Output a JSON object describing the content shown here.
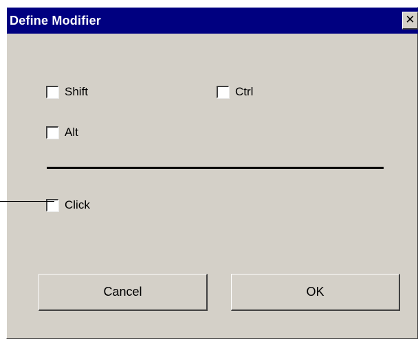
{
  "dialog": {
    "title": "Define Modifier",
    "close_label": "✕"
  },
  "modifiers": {
    "shift": {
      "label": "Shift",
      "checked": false
    },
    "ctrl": {
      "label": "Ctrl",
      "checked": false
    },
    "alt": {
      "label": "Alt",
      "checked": false
    },
    "click": {
      "label": "Click",
      "checked": false
    }
  },
  "buttons": {
    "cancel_label": "Cancel",
    "ok_label": "OK"
  },
  "colors": {
    "titlebar": "#000080",
    "dialog_face": "#d4d0c8",
    "title_text": "#ffffff"
  }
}
